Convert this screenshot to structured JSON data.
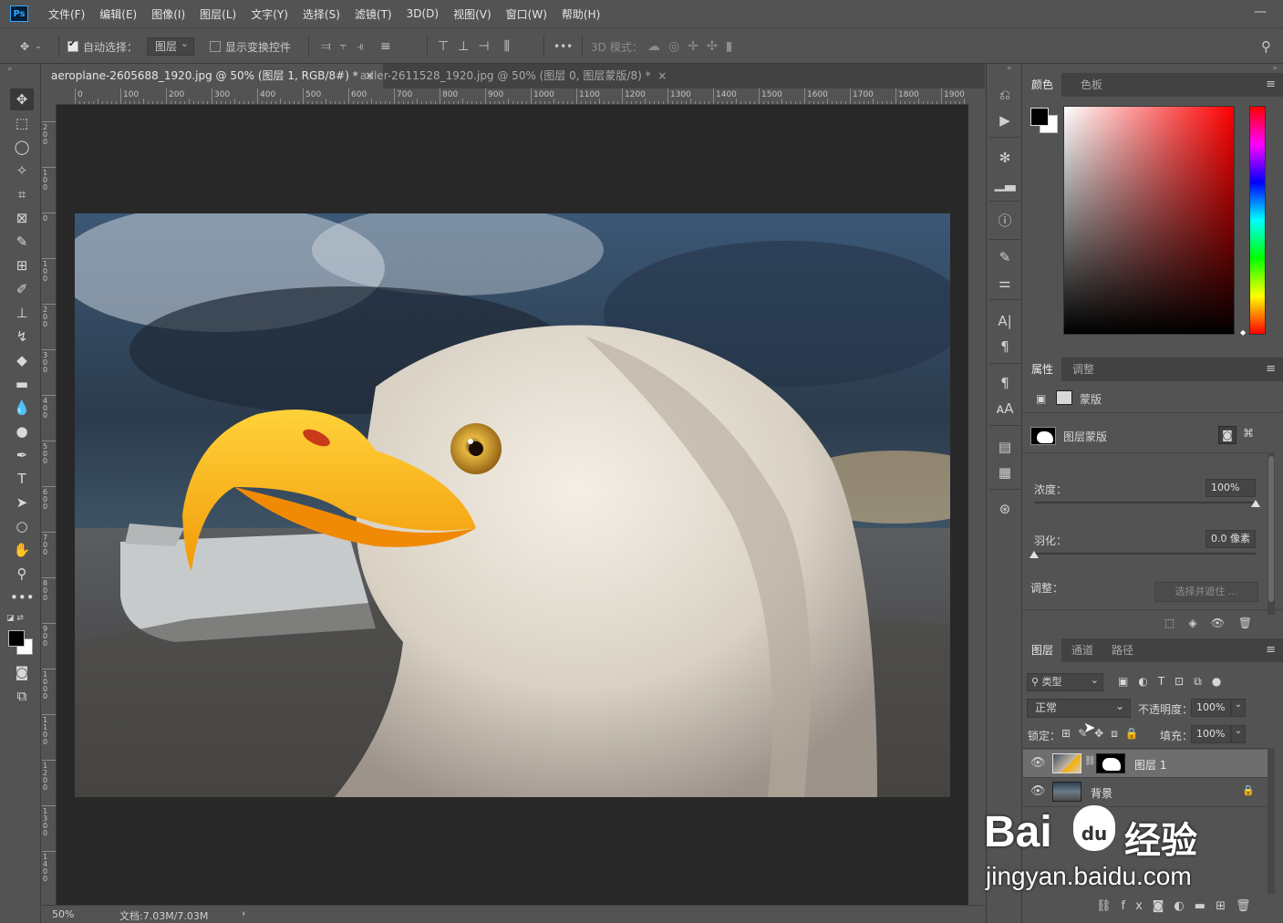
{
  "app": {
    "logo": "Ps"
  },
  "menu": [
    "文件(F)",
    "编辑(E)",
    "图像(I)",
    "图层(L)",
    "文字(Y)",
    "选择(S)",
    "滤镜(T)",
    "3D(D)",
    "视图(V)",
    "窗口(W)",
    "帮助(H)"
  ],
  "options": {
    "auto_select_label": "自动选择：",
    "auto_select_target": "图层",
    "show_transform_label": "显示变换控件",
    "mode_3d_label": "3D 模式：",
    "more": "•••"
  },
  "tabs": [
    {
      "label": "aeroplane-2605688_1920.jpg @ 50% (图层 1, RGB/8#) *",
      "close": "×"
    },
    {
      "label": "adler-2611528_1920.jpg @ 50% (图层 0, 图层蒙版/8) *",
      "close": "×"
    }
  ],
  "ruler_h": [
    "0",
    "100",
    "200",
    "300",
    "400",
    "500",
    "600",
    "700",
    "800",
    "900",
    "1000",
    "1100",
    "1200",
    "1300",
    "1400",
    "1500",
    "1600",
    "1700",
    "1800",
    "1900"
  ],
  "ruler_v": [
    "2 0 0",
    "1 0 0",
    "0",
    "1 0 0",
    "2 0 0",
    "3 0 0",
    "4 0 0",
    "5 0 0",
    "6 0 0",
    "7 0 0",
    "8 0 0",
    "9 0 0",
    "1 0 0 0",
    "1 1 0 0",
    "1 2 0 0",
    "1 3 0 0",
    "1 4 0 0"
  ],
  "status": {
    "zoom": "50%",
    "doc": "文档:7.03M/7.03M",
    "arrow": "›"
  },
  "color_panel": {
    "tabs": [
      "颜色",
      "色板"
    ],
    "fg": "#000000",
    "bg": "#ffffff",
    "hue": "#ff0000"
  },
  "properties_panel": {
    "tabs": [
      "属性",
      "调整"
    ],
    "mask_label": "蒙版",
    "layer_mask_label": "图层蒙版",
    "density_label": "浓度：",
    "density_value": "100%",
    "density_level": 1.0,
    "feather_label": "羽化：",
    "feather_value": "0.0 像素",
    "feather_level": 0.0,
    "adjust_label": "调整：",
    "select_and_mask": "选择并遮住 ..."
  },
  "layers_panel": {
    "tabs": [
      "图层",
      "通道",
      "路径"
    ],
    "filter_kind": "类型",
    "blend_mode": "正常",
    "opacity_label": "不透明度：",
    "opacity_value": "100%",
    "lock_label": "锁定：",
    "fill_label": "填充：",
    "fill_value": "100%",
    "layers": [
      {
        "name": "图层 1",
        "selected": true
      },
      {
        "name": "背景",
        "selected": false
      }
    ]
  },
  "watermark": {
    "brand": "Bai",
    "paw": "du",
    "cn": "经验",
    "url": "jingyan.baidu.com"
  }
}
